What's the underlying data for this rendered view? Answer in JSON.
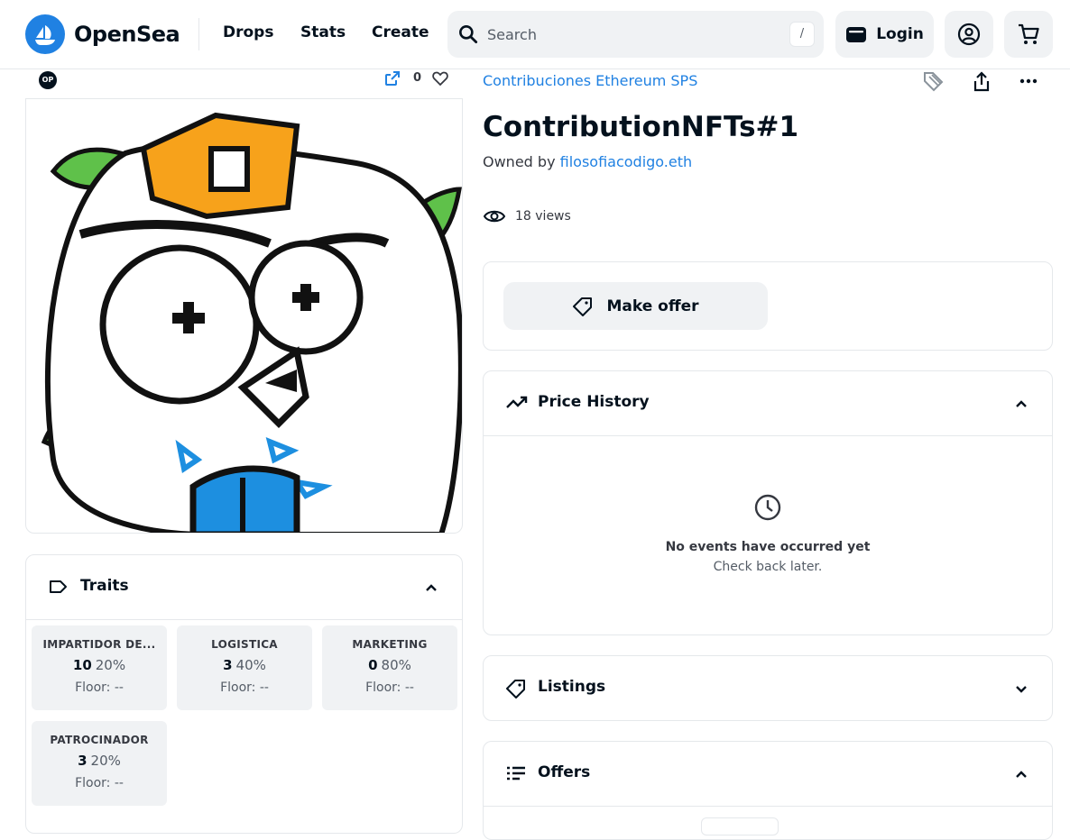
{
  "header": {
    "brand": "OpenSea",
    "nav": [
      "Drops",
      "Stats",
      "Create"
    ],
    "search_placeholder": "Search",
    "search_shortcut": "/",
    "login_label": "Login"
  },
  "asset": {
    "chain_badge": "OP",
    "favorites_count": "0",
    "collection": "Contribuciones Ethereum SPS",
    "title": "ContributionNFTs#1",
    "owned_by_prefix": "Owned by",
    "owner": "filosofiacodigo.eth",
    "views": "18 views"
  },
  "actions": {
    "make_offer": "Make offer"
  },
  "traits": {
    "title": "Traits",
    "items": [
      {
        "type": "IMPARTIDOR DE...",
        "value": "10",
        "pct": "20%",
        "floor": "Floor: --"
      },
      {
        "type": "LOGISTICA",
        "value": "3",
        "pct": "40%",
        "floor": "Floor: --"
      },
      {
        "type": "MARKETING",
        "value": "0",
        "pct": "80%",
        "floor": "Floor: --"
      },
      {
        "type": "PATROCINADOR",
        "value": "3",
        "pct": "20%",
        "floor": "Floor: --"
      }
    ]
  },
  "price_history": {
    "title": "Price History",
    "empty_title": "No events have occurred yet",
    "empty_sub": "Check back later."
  },
  "listings": {
    "title": "Listings"
  },
  "offers": {
    "title": "Offers"
  },
  "colors": {
    "accent": "#2081e2",
    "owl_orange": "#f7a21b",
    "leaf_green": "#5fc14a",
    "book_blue": "#1d8fe0"
  }
}
